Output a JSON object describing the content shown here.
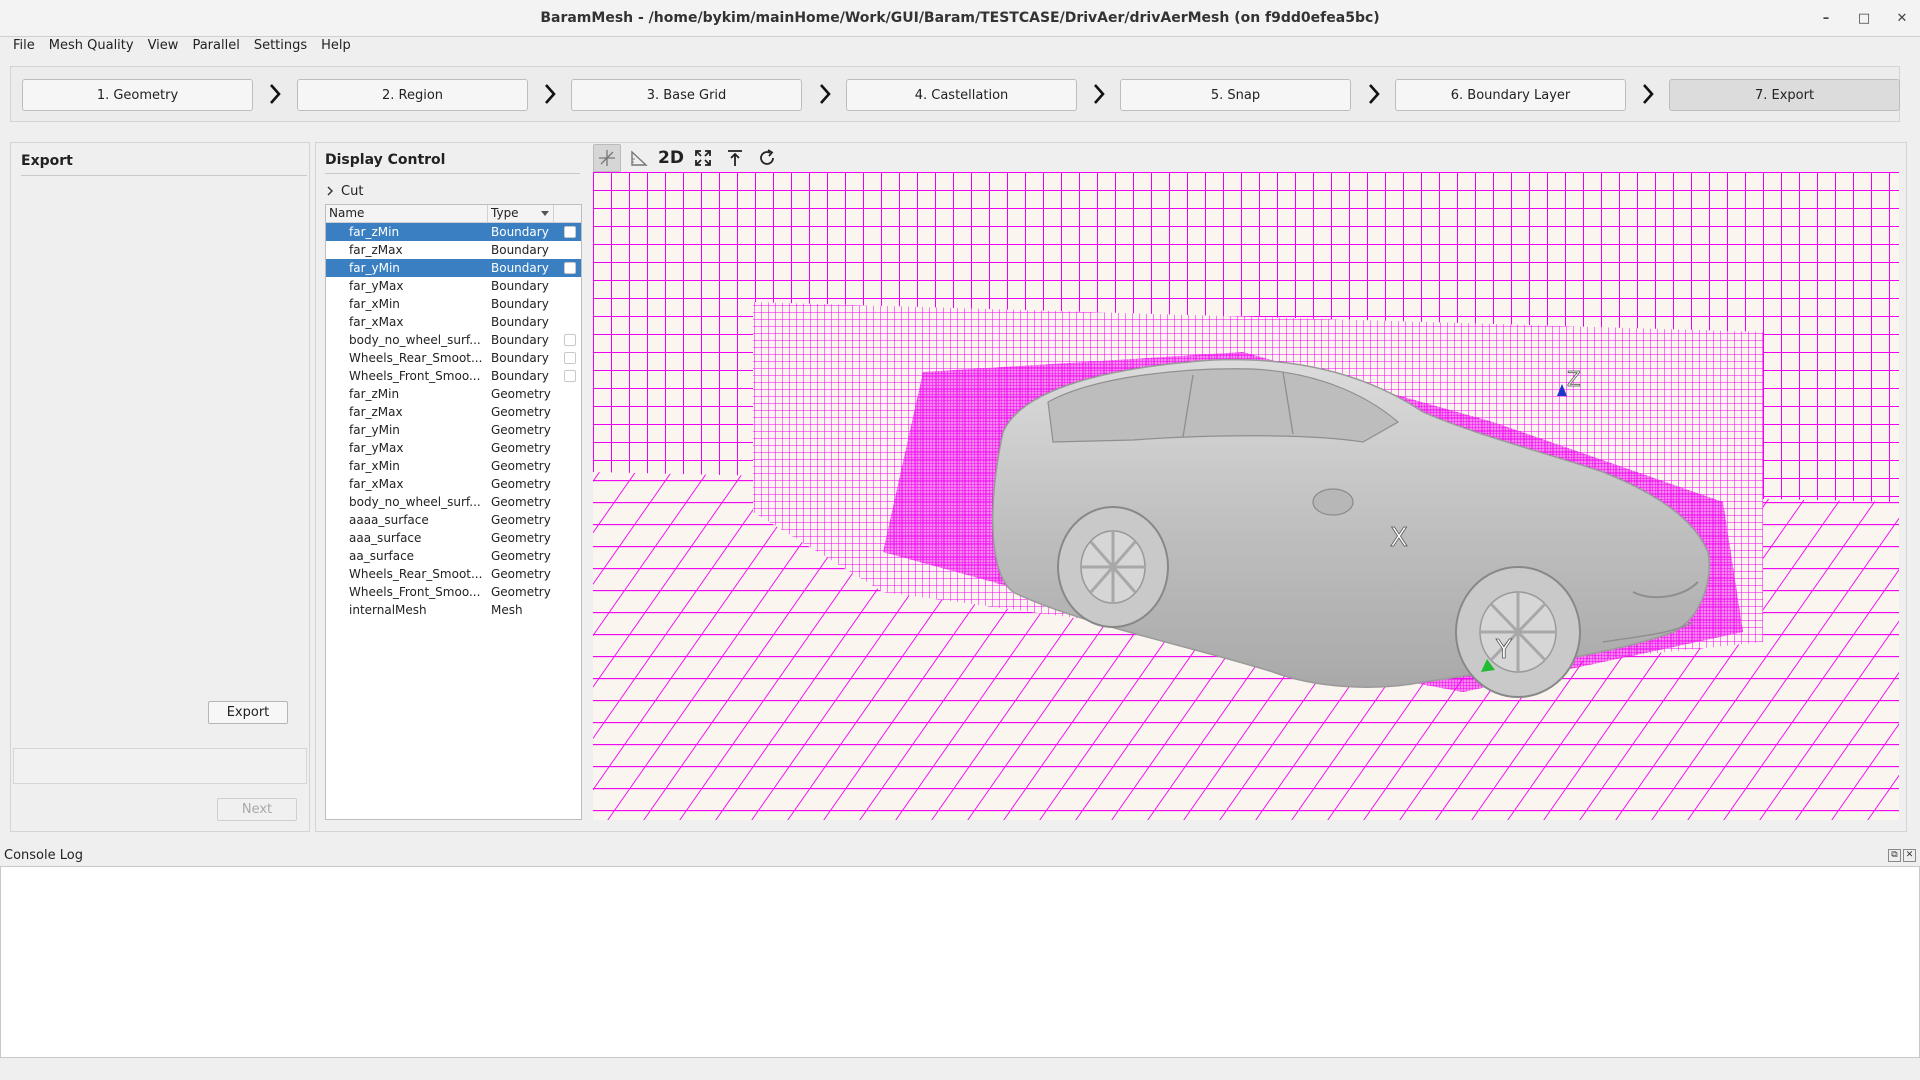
{
  "window": {
    "title": "BaramMesh - /home/bykim/mainHome/Work/GUI/Baram/TESTCASE/DrivAer/drivAerMesh (on f9dd0efea5bc)",
    "controls": [
      "–",
      "□",
      "✕"
    ]
  },
  "menu": [
    "File",
    "Mesh Quality",
    "View",
    "Parallel",
    "Settings",
    "Help"
  ],
  "steps": [
    {
      "label": "1. Geometry",
      "active": false
    },
    {
      "label": "2. Region",
      "active": false
    },
    {
      "label": "3. Base Grid",
      "active": false
    },
    {
      "label": "4. Castellation",
      "active": false
    },
    {
      "label": "5. Snap",
      "active": false
    },
    {
      "label": "6. Boundary Layer",
      "active": false
    },
    {
      "label": "7. Export",
      "active": true
    }
  ],
  "export_panel": {
    "title": "Export",
    "export_button": "Export",
    "next_button": "Next"
  },
  "display_control": {
    "title": "Display Control",
    "cut_label": "Cut",
    "columns": [
      "Name",
      "Type"
    ],
    "rows": [
      {
        "name": "far_zMin",
        "type": "Boundary",
        "selected": true,
        "checkbox": true
      },
      {
        "name": "far_zMax",
        "type": "Boundary",
        "selected": false,
        "checkbox": false
      },
      {
        "name": "far_yMin",
        "type": "Boundary",
        "selected": true,
        "checkbox": true
      },
      {
        "name": "far_yMax",
        "type": "Boundary",
        "selected": false,
        "checkbox": false
      },
      {
        "name": "far_xMin",
        "type": "Boundary",
        "selected": false,
        "checkbox": false
      },
      {
        "name": "far_xMax",
        "type": "Boundary",
        "selected": false,
        "checkbox": false
      },
      {
        "name": "body_no_wheel_surf...",
        "type": "Boundary",
        "selected": false,
        "checkbox": true
      },
      {
        "name": "Wheels_Rear_Smoot...",
        "type": "Boundary",
        "selected": false,
        "checkbox": true
      },
      {
        "name": "Wheels_Front_Smoo...",
        "type": "Boundary",
        "selected": false,
        "checkbox": true
      },
      {
        "name": "far_zMin",
        "type": "Geometry",
        "selected": false,
        "checkbox": false
      },
      {
        "name": "far_zMax",
        "type": "Geometry",
        "selected": false,
        "checkbox": false
      },
      {
        "name": "far_yMin",
        "type": "Geometry",
        "selected": false,
        "checkbox": false
      },
      {
        "name": "far_yMax",
        "type": "Geometry",
        "selected": false,
        "checkbox": false
      },
      {
        "name": "far_xMin",
        "type": "Geometry",
        "selected": false,
        "checkbox": false
      },
      {
        "name": "far_xMax",
        "type": "Geometry",
        "selected": false,
        "checkbox": false
      },
      {
        "name": "body_no_wheel_surf...",
        "type": "Geometry",
        "selected": false,
        "checkbox": false
      },
      {
        "name": "aaaa_surface",
        "type": "Geometry",
        "selected": false,
        "checkbox": false
      },
      {
        "name": "aaa_surface",
        "type": "Geometry",
        "selected": false,
        "checkbox": false
      },
      {
        "name": "aa_surface",
        "type": "Geometry",
        "selected": false,
        "checkbox": false
      },
      {
        "name": "Wheels_Rear_Smoot...",
        "type": "Geometry",
        "selected": false,
        "checkbox": false
      },
      {
        "name": "Wheels_Front_Smoo...",
        "type": "Geometry",
        "selected": false,
        "checkbox": false
      },
      {
        "name": "internalMesh",
        "type": "Mesh",
        "selected": false,
        "checkbox": false
      }
    ]
  },
  "viewer": {
    "toolbar": [
      {
        "icon": "axes-icon",
        "label": ""
      },
      {
        "icon": "ruler-triangle-icon",
        "label": ""
      },
      {
        "icon": "2d-view-icon",
        "label": "2D"
      },
      {
        "icon": "fit-view-icon",
        "label": ""
      },
      {
        "icon": "align-top-icon",
        "label": ""
      },
      {
        "icon": "rotate-icon",
        "label": ""
      }
    ],
    "axis_labels": {
      "x": "X",
      "y": "Y",
      "z": "Z"
    },
    "colors": {
      "mesh": "#ff00ff",
      "background": "#fbf5ef",
      "car": "#c7c7c7"
    }
  },
  "console": {
    "title": "Console Log"
  }
}
